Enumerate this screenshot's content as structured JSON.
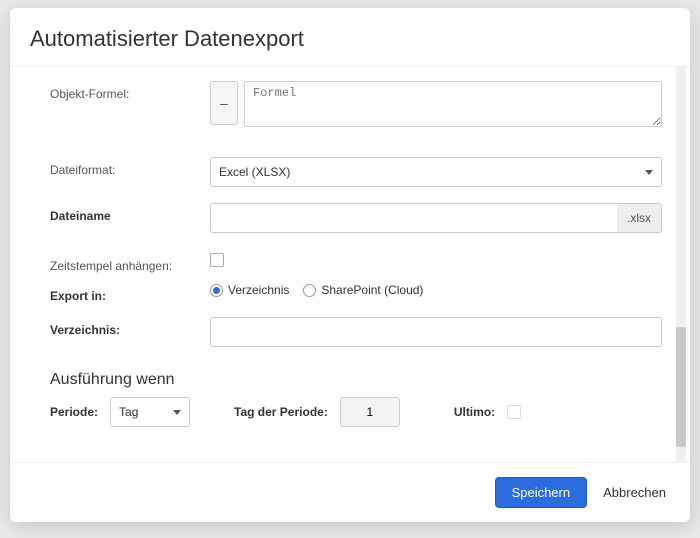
{
  "modal": {
    "title": "Automatisierter Datenexport"
  },
  "form": {
    "object_formula": {
      "label": "Objekt-Formel:",
      "placeholder": "Formel",
      "button_label": "–"
    },
    "file_format": {
      "label": "Dateiformat:",
      "selected": "Excel (XLSX)"
    },
    "file_name": {
      "label": "Dateiname",
      "value": "",
      "addon": ".xlsx"
    },
    "timestamp": {
      "label": "Zeitstempel anhängen:"
    },
    "export_target": {
      "label": "Export in:",
      "options": [
        {
          "label": "Verzeichnis",
          "checked": true
        },
        {
          "label": "SharePoint (Cloud)",
          "checked": false
        }
      ]
    },
    "directory": {
      "label": "Verzeichnis:",
      "value": ""
    }
  },
  "execution": {
    "title": "Ausführung wenn",
    "period": {
      "label": "Periode:",
      "selected": "Tag"
    },
    "day_of_period": {
      "label": "Tag der Periode:",
      "value": "1"
    },
    "ultimo": {
      "label": "Ultimo:"
    }
  },
  "footer": {
    "save": "Speichern",
    "cancel": "Abbrechen"
  }
}
